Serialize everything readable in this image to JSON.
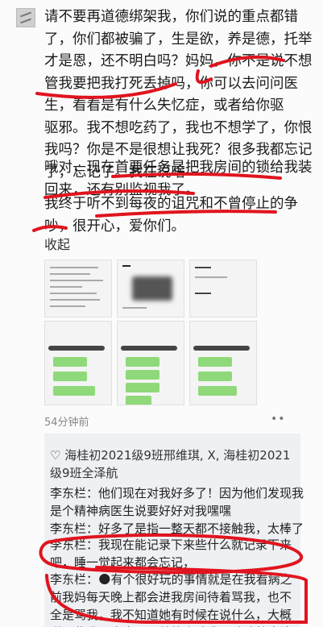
{
  "post": {
    "paragraphs": [
      {
        "text": "请不要再道德绑架我，你们说的重点都错\n了，你们都被骗了，生是欲，养是德，托举\n才是恩，还不明白吗？妈妈，你不是说不想\n管我要把我打死丢掉吗，你可以去问问医\n生，看看是有什么失忆症，或者给你驱\n驱邪。我不想吃药了，我也不想学了，你恨\n我吗？你是不是很想让我死？很多我都忘记\n了，忘记了。我在说啥"
      },
      {
        "text": "哦对，现在首要任务是把我房间的锁给我装\n回来，还有别监视我了。"
      },
      {
        "text": "我终于听不到每夜的诅咒和不曾停止的争\n吵，很开心，爱你们。"
      }
    ],
    "collapse_label": "收起",
    "timestamp": "54分钟前",
    "more_label": "••"
  },
  "comments": {
    "likes": "♡ 海桂初2021级9班邢维琪, X, 海桂初2021\n级9班全泽航",
    "items": [
      {
        "text": "李东栏：他们现在对我好多了！因为他们发现我\n是个精神病医生说要好好对我嘿嘿"
      },
      {
        "text": "李东栏：好多了是指一整天都不接触我，太棒了"
      },
      {
        "text": "李东栏：我现在能记录下来些什么就记录下来\n吧，睡一觉起来都会忘记，"
      },
      {
        "text": "李东栏：🌑有个很好玩的事情就是在我看病之\n前我妈每天晚上都会进我房间待着骂我，也不\n全是骂我，我不知道她有时候在说什么，大概\n说一些我是全中国最差的小孩我是歇鸡就应该"
      }
    ]
  },
  "colors": {
    "annotation": "#e0141e",
    "chat_bubble": "#8fd97a",
    "comment_bg": "#eef0f3"
  }
}
